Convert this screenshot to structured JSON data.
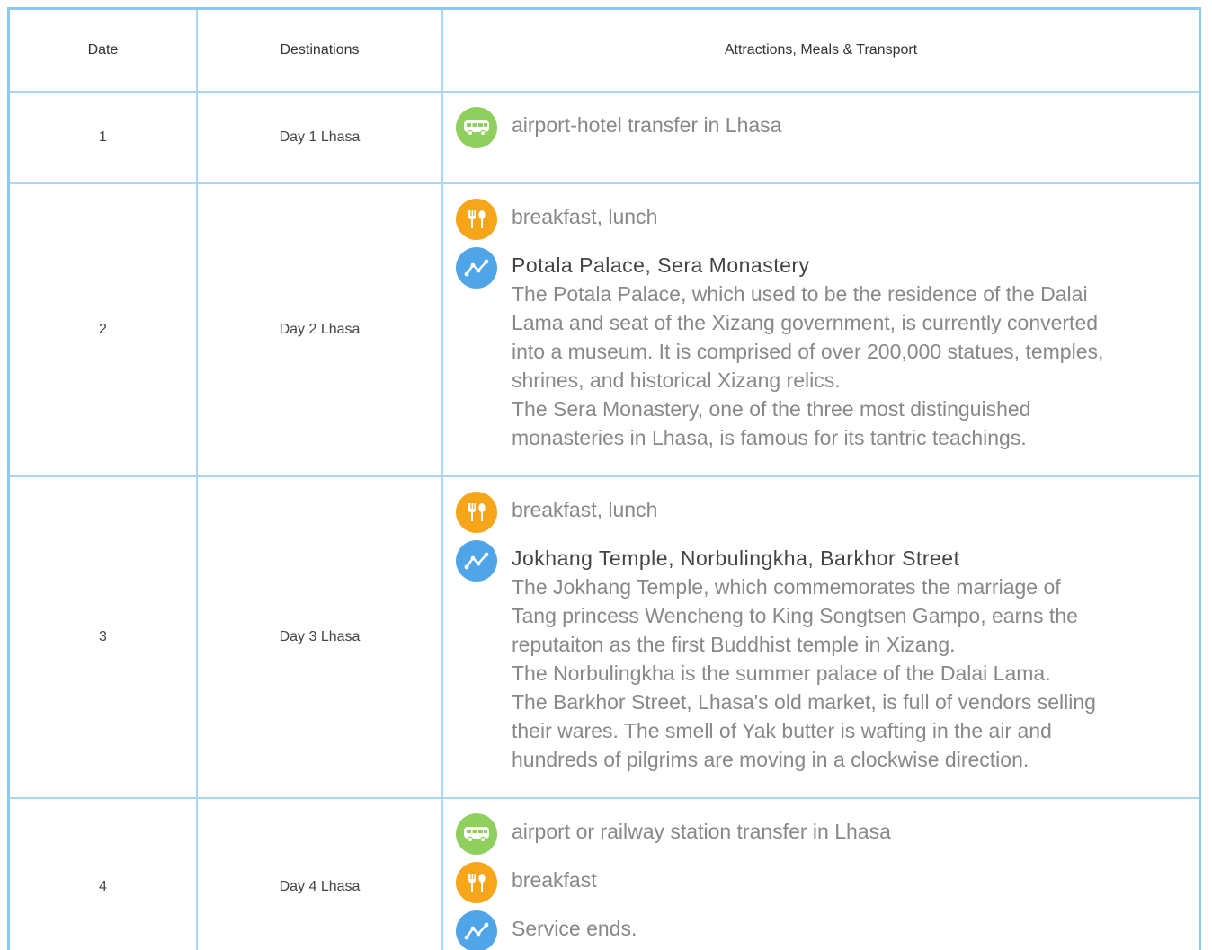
{
  "header": {
    "date": "Date",
    "destinations": "Destinations",
    "details": "Attractions, Meals & Transport"
  },
  "rows": [
    {
      "date": "1",
      "destination": "Day 1 Lhasa",
      "transport": "airport-hotel transfer in Lhasa"
    },
    {
      "date": "2",
      "destination": "Day 2 Lhasa",
      "meals": "breakfast, lunch",
      "attractions_title": "Potala Palace, Sera Monastery",
      "description": "The Potala Palace, which used to be the residence of the Dalai\nLama and seat of the Xizang government, is currently converted\ninto a museum. It is comprised of over 200,000 statues, temples,\nshrines, and historical Xizang relics.\nThe Sera Monastery, one of the three most distinguished\nmonasteries in Lhasa, is famous for its tantric teachings."
    },
    {
      "date": "3",
      "destination": "Day 3 Lhasa",
      "meals": "breakfast, lunch",
      "attractions_title": "Jokhang Temple, Norbulingkha, Barkhor Street",
      "description": "The Jokhang Temple, which commemorates the marriage of\nTang princess Wencheng to King Songtsen Gampo, earns the\nreputaiton as the first Buddhist temple in Xizang.\nThe Norbulingkha is the summer palace of the Dalai Lama.\nThe Barkhor Street, Lhasa's old market, is full of vendors selling\ntheir wares. The smell of Yak butter is wafting in the air and\nhundreds of pilgrims are moving in a clockwise direction."
    },
    {
      "date": "4",
      "destination": "Day 4 Lhasa",
      "transport": "airport or railway station transfer in Lhasa",
      "meals": "breakfast",
      "activity": "Service ends."
    }
  ],
  "icons": {
    "transport": "bus-icon",
    "meals": "fork-spoon-icon",
    "attractions": "route-icon"
  },
  "colors": {
    "border": "#a9d6f3",
    "transport": "#8fcf5e",
    "meals": "#f7a51b",
    "attractions": "#4fa5e8"
  }
}
